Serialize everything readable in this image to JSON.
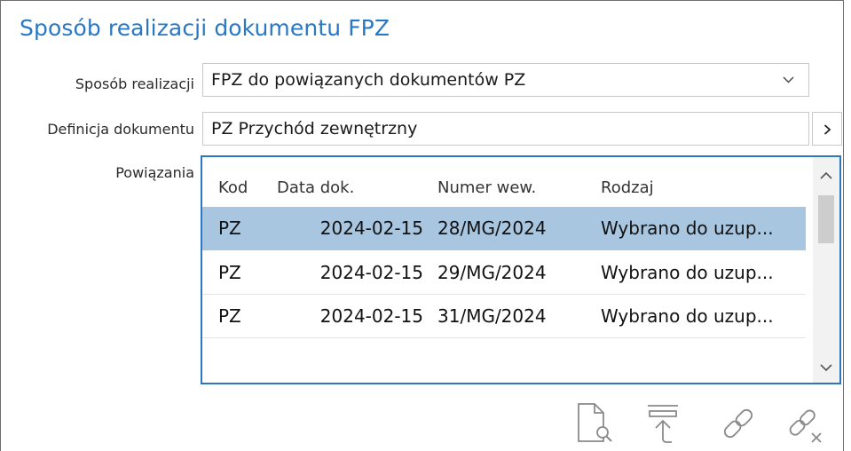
{
  "section": {
    "title": "Sposób realizacji dokumentu FPZ"
  },
  "fields": {
    "sposob_label": "Sposób realizacji",
    "sposob_value": "FPZ do powiązanych dokumentów PZ",
    "definicja_label": "Definicja dokumentu",
    "definicja_value": "PZ Przychód zewnętrzny",
    "powiazania_label": "Powiązania"
  },
  "grid": {
    "columns": [
      "Kod",
      "Data dok.",
      "Numer wew.",
      "Rodzaj"
    ],
    "rows": [
      {
        "kod": "PZ",
        "data": "2024-02-15",
        "numer": "28/MG/2024",
        "rodzaj": "Wybrano do uzup..."
      },
      {
        "kod": "PZ",
        "data": "2024-02-15",
        "numer": "29/MG/2024",
        "rodzaj": "Wybrano do uzup..."
      },
      {
        "kod": "PZ",
        "data": "2024-02-15",
        "numer": "31/MG/2024",
        "rodzaj": "Wybrano do uzup..."
      }
    ],
    "selected_row": 0
  },
  "toolbar": {
    "icons": [
      "document-preview-icon",
      "export-icon",
      "link-icon",
      "unlink-icon"
    ]
  },
  "colors": {
    "accent": "#2a78c4",
    "selection": "#a9c6e0"
  }
}
